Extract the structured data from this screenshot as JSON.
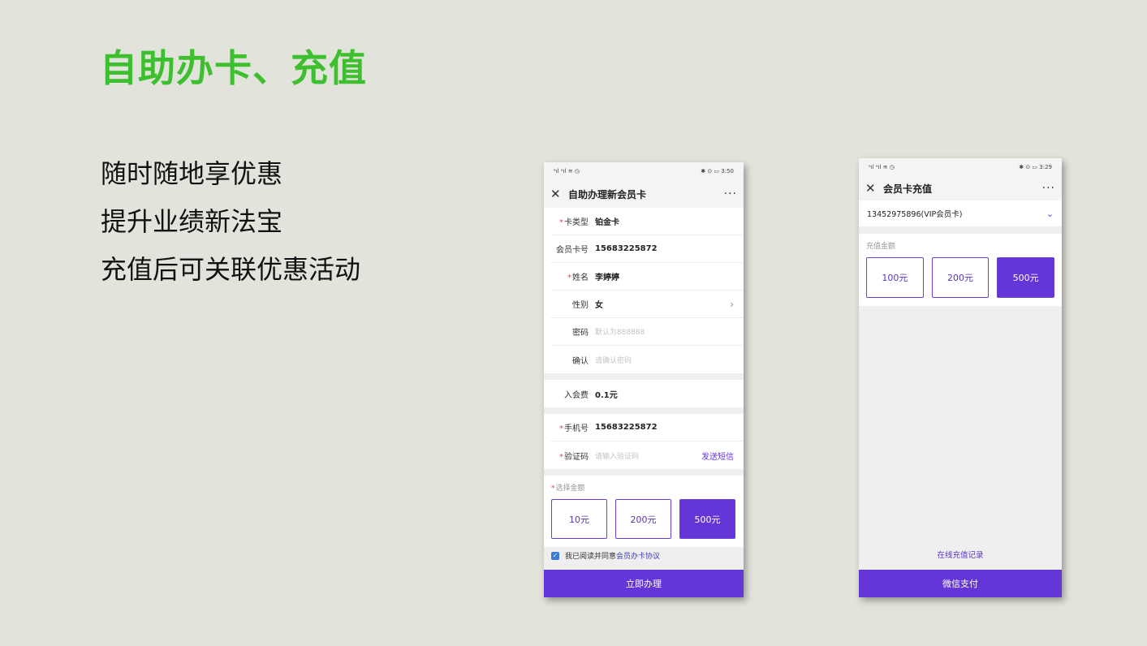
{
  "slide": {
    "title": "自助办卡、充值",
    "bullets": [
      "随时随地享优惠",
      "提升业绩新法宝",
      "充值后可关联优惠活动"
    ]
  },
  "phone1": {
    "status_left": "ᵃıl ᵃıl ≋ ◷",
    "status_right": "✱ ⊙ ▭ 3:50",
    "nav_title": "自助办理新会员卡",
    "close_icon": "✕",
    "more_icon": "···",
    "form": {
      "card_type_label": "卡类型",
      "card_type_value": "铂金卡",
      "card_no_label": "会员卡号",
      "card_no_value": "15683225872",
      "name_label": "姓名",
      "name_value": "李婷婷",
      "gender_label": "性别",
      "gender_value": "女",
      "password_label": "密码",
      "password_placeholder": "默认为888888",
      "confirm_label": "确认",
      "confirm_placeholder": "请确认密码",
      "fee_label": "入会费",
      "fee_value": "0.1元",
      "phone_label": "手机号",
      "phone_value": "15683225872",
      "code_label": "验证码",
      "code_placeholder": "请输入验证码",
      "send_sms": "发送短信"
    },
    "amount_label": "选择金额",
    "amounts": [
      "10元",
      "200元",
      "500元"
    ],
    "selected_amount": "500元",
    "agree_text": "我已阅读并同意",
    "agree_link": "会员办卡协议",
    "submit": "立即办理"
  },
  "phone2": {
    "status_left": "ᵃıl ᵃıl ≋ ◷",
    "status_right": "✱ ⊙ ▭ 3:29",
    "nav_title": "会员卡充值",
    "close_icon": "✕",
    "more_icon": "···",
    "card_select": "13452975896(VIP会员卡)",
    "amount_label": "充值金额",
    "amounts": [
      "100元",
      "200元",
      "500元"
    ],
    "selected_amount": "500元",
    "history_link": "在线充值记录",
    "pay": "微信支付"
  },
  "colors": {
    "title_green": "#3dbf2f",
    "brand_purple": "#6436d8",
    "background": "#e2e3da"
  }
}
